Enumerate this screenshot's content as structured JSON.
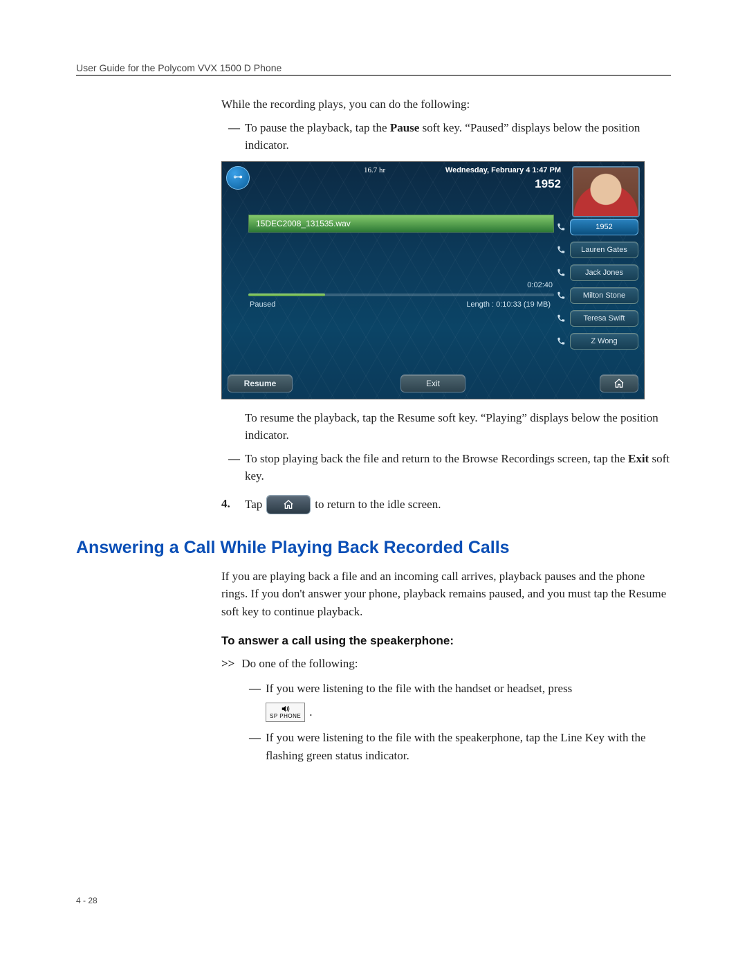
{
  "header": {
    "running_head": "User Guide for the Polycom VVX 1500 D Phone"
  },
  "intro": {
    "para": "While the recording plays, you can do the following:",
    "bullet1a": "To pause the playback, tap the ",
    "bullet1b": "Pause",
    "bullet1c": " soft key. “Paused” displays below the position indicator."
  },
  "screenshot": {
    "usb_symbol": "•➡",
    "hours": "16.7 hr",
    "date": "Wednesday, February 4  1:47 PM",
    "extension": "1952",
    "filename": "15DEC2008_131535.wav",
    "elapsed": "0:02:40",
    "progress_percent": 25,
    "status_left": "Paused",
    "length_label": "Length :  0:10:33 (19 MB)",
    "line_keys": [
      {
        "label": "1952",
        "active": true
      },
      {
        "label": "Lauren Gates",
        "active": false
      },
      {
        "label": "Jack Jones",
        "active": false
      },
      {
        "label": "Milton Stone",
        "active": false
      },
      {
        "label": "Teresa Swift",
        "active": false
      },
      {
        "label": "Z Wong",
        "active": false
      }
    ],
    "softkeys": {
      "resume": "Resume",
      "exit": "Exit"
    }
  },
  "after": {
    "resume_para": "To resume the playback, tap the Resume soft key. “Playing” displays below the position indicator.",
    "stop1": "To stop playing back the file and return to the Browse Recordings screen, tap the ",
    "stop2": "Exit",
    "stop3": " soft key.",
    "step4_num": "4.",
    "step4_a": "Tap",
    "step4_b": "to return to the idle screen."
  },
  "section": {
    "heading": "Answering a Call While Playing Back Recorded Calls",
    "para": "If you are playing back a file and an incoming call arrives, playback pauses and the phone rings. If you don't answer your phone, playback remains paused, and you must tap the Resume soft key to continue playback.",
    "subhead": "To answer a call using the speakerphone:",
    "chevrons": ">>",
    "do_one": "Do one of the following:",
    "b1": "If you were listening to the file with the handset or headset, press",
    "sp_label": "SP PHONE",
    "period": ".",
    "b2": "If you were listening to the file with the speakerphone, tap the Line Key with the flashing green status indicator."
  },
  "footer": {
    "page": "4 - 28"
  }
}
